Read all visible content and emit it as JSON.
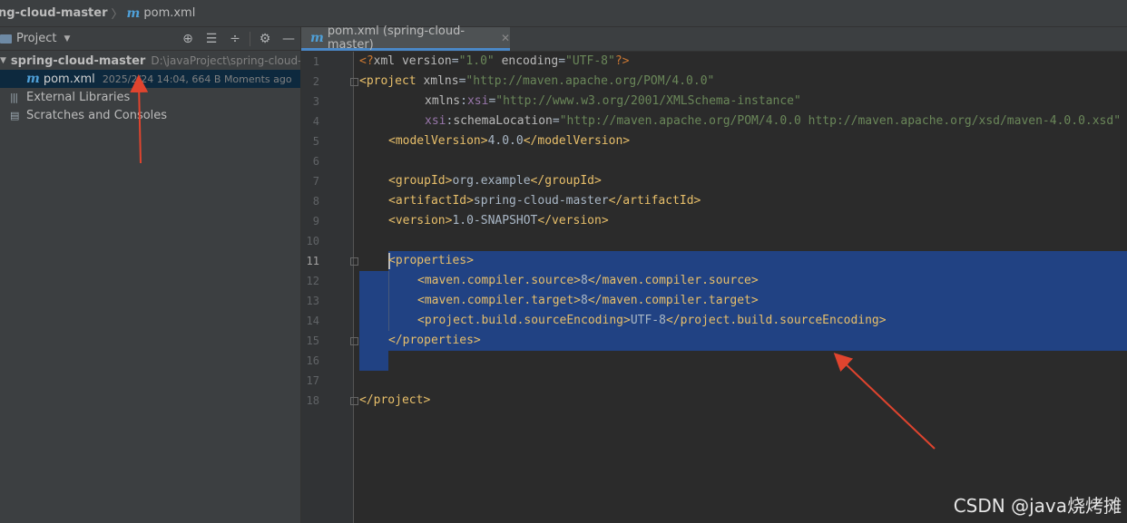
{
  "breadcrumb": {
    "project": "ng-cloud-master",
    "file": "pom.xml"
  },
  "sidebar": {
    "title": "Project",
    "tools": [
      "locate-icon",
      "expand-all-icon",
      "collapse-all-icon",
      "gear-icon",
      "minimize-icon"
    ],
    "project_name": "spring-cloud-master",
    "project_path": "D:\\javaProject\\spring-cloud-m",
    "pom_file": "pom.xml",
    "pom_meta": "2025/2/24 14:04, 664 B Moments ago",
    "external_libraries": "External Libraries",
    "scratches": "Scratches and Consoles"
  },
  "tab": {
    "label": "pom.xml (spring-cloud-master)"
  },
  "editor": {
    "line_numbers": [
      "1",
      "2",
      "3",
      "4",
      "5",
      "6",
      "7",
      "8",
      "9",
      "10",
      "11",
      "12",
      "13",
      "14",
      "15",
      "16",
      "17",
      "18"
    ],
    "current_line": 11,
    "code": {
      "l1_decl_open": "<?",
      "l1_xml": "xml ",
      "l1_version_attr": "version",
      "l1_version_val": "\"1.0\"",
      "l1_encoding_attr": "encoding",
      "l1_encoding_val": "\"UTF-8\"",
      "l1_decl_close": "?>",
      "l2_tag": "<project ",
      "l2_attr": "xmlns",
      "l2_val": "\"http://maven.apache.org/POM/4.0.0\"",
      "l3_attr": "xmlns",
      "l3_ns": "xsi",
      "l3_val": "\"http://www.w3.org/2001/XMLSchema-instance\"",
      "l4_ns": "xsi",
      "l4_attr": "schemaLocation",
      "l4_val": "\"http://maven.apache.org/POM/4.0.0 http://maven.apache.org/xsd/maven-4.0.0.xsd\"",
      "l5_open": "<modelVersion>",
      "l5_text": "4.0.0",
      "l5_close": "</modelVersion>",
      "l7_open": "<groupId>",
      "l7_text": "org.example",
      "l7_close": "</groupId>",
      "l8_open": "<artifactId>",
      "l8_text": "spring-cloud-master",
      "l8_close": "</artifactId>",
      "l9_open": "<version>",
      "l9_text": "1.0-SNAPSHOT",
      "l9_close": "</version>",
      "l11_open": "<properties>",
      "l12_open": "<maven.compiler.source>",
      "l12_text": "8",
      "l12_close": "</maven.compiler.source>",
      "l13_open": "<maven.compiler.target>",
      "l13_text": "8",
      "l13_close": "</maven.compiler.target>",
      "l14_open": "<project.build.sourceEncoding>",
      "l14_text": "UTF-8",
      "l14_close": "</project.build.sourceEncoding>",
      "l15_close": "</properties>",
      "l18_close": "</project>"
    }
  },
  "watermark": "CSDN @java烧烤摊",
  "colors": {
    "selection": "#214283",
    "tag": "#e8bf6a",
    "string": "#6a8759",
    "annotation_arrow": "#e0442e"
  }
}
